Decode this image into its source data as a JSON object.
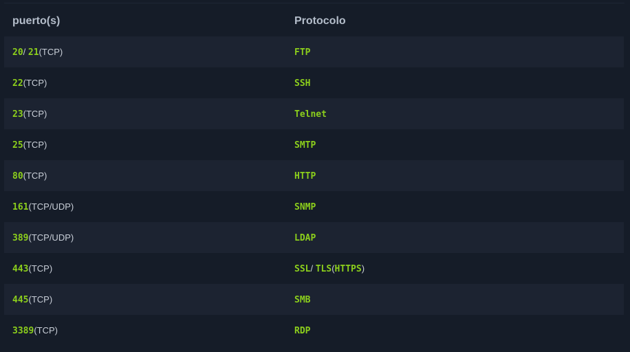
{
  "header": {
    "col1": "puerto(s)",
    "col2": "Protocolo"
  },
  "rows": [
    {
      "port": [
        {
          "t": "20",
          "c": true
        },
        {
          "t": "/ ",
          "c": false
        },
        {
          "t": "21",
          "c": true
        },
        {
          "t": "(TCP)",
          "c": false
        }
      ],
      "proto": [
        {
          "t": "FTP",
          "c": true
        }
      ]
    },
    {
      "port": [
        {
          "t": "22",
          "c": true
        },
        {
          "t": "(TCP)",
          "c": false
        }
      ],
      "proto": [
        {
          "t": "SSH",
          "c": true
        }
      ]
    },
    {
      "port": [
        {
          "t": "23",
          "c": true
        },
        {
          "t": "(TCP)",
          "c": false
        }
      ],
      "proto": [
        {
          "t": "Telnet",
          "c": true
        }
      ]
    },
    {
      "port": [
        {
          "t": "25",
          "c": true
        },
        {
          "t": "(TCP)",
          "c": false
        }
      ],
      "proto": [
        {
          "t": "SMTP",
          "c": true
        }
      ]
    },
    {
      "port": [
        {
          "t": "80",
          "c": true
        },
        {
          "t": "(TCP)",
          "c": false
        }
      ],
      "proto": [
        {
          "t": "HTTP",
          "c": true
        }
      ]
    },
    {
      "port": [
        {
          "t": "161",
          "c": true
        },
        {
          "t": "(TCP/UDP)",
          "c": false
        }
      ],
      "proto": [
        {
          "t": "SNMP",
          "c": true
        }
      ]
    },
    {
      "port": [
        {
          "t": "389",
          "c": true
        },
        {
          "t": "(TCP/UDP)",
          "c": false
        }
      ],
      "proto": [
        {
          "t": "LDAP",
          "c": true
        }
      ]
    },
    {
      "port": [
        {
          "t": "443",
          "c": true
        },
        {
          "t": "(TCP)",
          "c": false
        }
      ],
      "proto": [
        {
          "t": "SSL",
          "c": true
        },
        {
          "t": "/ ",
          "c": false
        },
        {
          "t": "TLS",
          "c": true
        },
        {
          "t": "(",
          "c": false
        },
        {
          "t": "HTTPS",
          "c": true
        },
        {
          "t": ")",
          "c": false
        }
      ]
    },
    {
      "port": [
        {
          "t": "445",
          "c": true
        },
        {
          "t": "(TCP)",
          "c": false
        }
      ],
      "proto": [
        {
          "t": "SMB",
          "c": true
        }
      ]
    },
    {
      "port": [
        {
          "t": "3389",
          "c": true
        },
        {
          "t": "(TCP)",
          "c": false
        }
      ],
      "proto": [
        {
          "t": "RDP",
          "c": true
        }
      ]
    }
  ]
}
